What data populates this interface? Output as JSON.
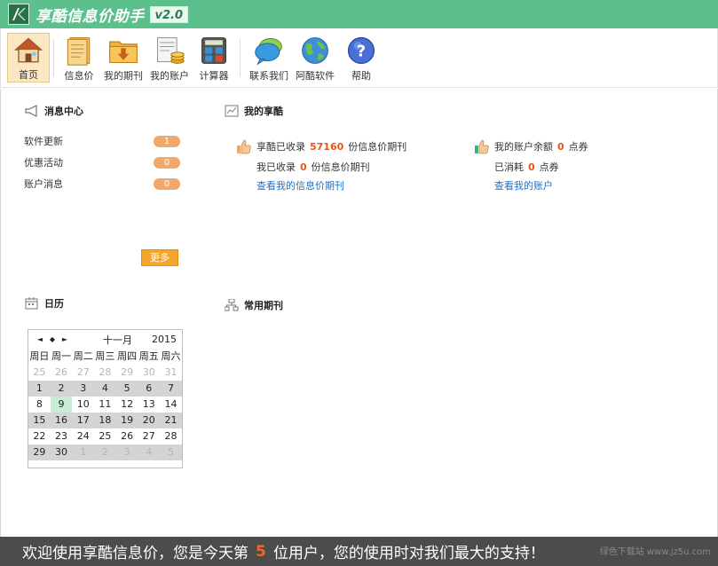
{
  "app": {
    "title": "享酷信息价助手",
    "version": "v2.0"
  },
  "toolbar": {
    "items": [
      {
        "label": "首页",
        "icon": "home-icon"
      },
      {
        "label": "信息价",
        "icon": "document-icon"
      },
      {
        "label": "我的期刊",
        "icon": "folder-download-icon"
      },
      {
        "label": "我的账户",
        "icon": "coins-icon"
      },
      {
        "label": "计算器",
        "icon": "calculator-icon"
      },
      {
        "label": "联系我们",
        "icon": "chat-bubble-icon"
      },
      {
        "label": "阿酷软件",
        "icon": "globe-icon"
      },
      {
        "label": "帮助",
        "icon": "help-icon"
      }
    ]
  },
  "messages": {
    "title": "消息中心",
    "items": [
      {
        "label": "软件更新",
        "count": "1"
      },
      {
        "label": "优惠活动",
        "count": "0"
      },
      {
        "label": "账户消息",
        "count": "0"
      }
    ],
    "more_label": "更多"
  },
  "my_xiangku": {
    "title": "我的享酷",
    "collected_prefix": "享酷已收录",
    "collected_count": "57160",
    "collected_suffix": "份信息价期刊",
    "mine_prefix": "我已收录",
    "mine_count": "0",
    "mine_suffix": "份信息价期刊",
    "view_journals_link": "查看我的信息价期刊",
    "balance_prefix": "我的账户余额",
    "balance_count": "0",
    "balance_suffix": "点券",
    "spent_prefix": "已消耗",
    "spent_count": "0",
    "spent_suffix": "点券",
    "view_account_link": "查看我的账户"
  },
  "calendar": {
    "title": "日历",
    "month": "十一月",
    "year": "2015",
    "nav_prev": "◄",
    "nav_today": "◆",
    "nav_next": "►",
    "weekdays": [
      "周日",
      "周一",
      "周二",
      "周三",
      "周四",
      "周五",
      "周六"
    ],
    "weeks": [
      [
        "25",
        "26",
        "27",
        "28",
        "29",
        "30",
        "31"
      ],
      [
        "1",
        "2",
        "3",
        "4",
        "5",
        "6",
        "7"
      ],
      [
        "8",
        "9",
        "10",
        "11",
        "12",
        "13",
        "14"
      ],
      [
        "15",
        "16",
        "17",
        "18",
        "19",
        "20",
        "21"
      ],
      [
        "22",
        "23",
        "24",
        "25",
        "26",
        "27",
        "28"
      ],
      [
        "29",
        "30",
        "1",
        "2",
        "3",
        "4",
        "5"
      ]
    ],
    "today": "9"
  },
  "common_journals": {
    "title": "常用期刊"
  },
  "status": {
    "prefix": "欢迎使用享酷信息价，您是今天第",
    "user_number": "5",
    "suffix": "位用户，您的使用时对我们最大的支持！",
    "watermark": "绿色下载站 www.jz5u.com"
  },
  "colors": {
    "titlebar": "#5cc08d",
    "accent_orange": "#f4a62a",
    "link_blue": "#1e6ec8",
    "highlight_number": "#e8561a",
    "statusbar": "#4c4c4c"
  }
}
